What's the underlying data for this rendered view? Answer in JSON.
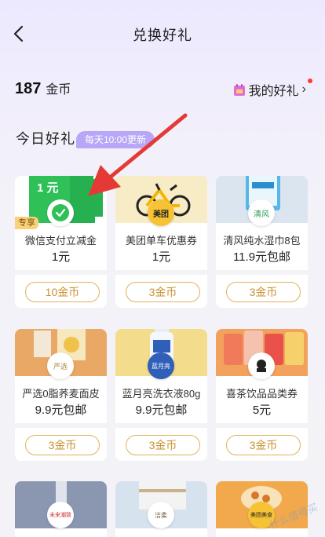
{
  "header": {
    "title": "兑换好礼"
  },
  "balance": {
    "amount": "187",
    "unit": "金币"
  },
  "my_gifts": {
    "label": "我的好礼",
    "chevron": "›"
  },
  "section": {
    "title": "今日好礼",
    "badge": "每天10:00更新"
  },
  "cards": [
    {
      "name": "微信支付立减金",
      "price": "1元",
      "button": "10金币",
      "tag": "专享",
      "top_label": "1 元",
      "icon": "wechat-icon"
    },
    {
      "name": "美团单车优惠券",
      "price": "1元",
      "button": "3金币",
      "icon": "meituan-logo"
    },
    {
      "name": "清风纯水湿巾8包",
      "price": "11.9元包邮",
      "button": "3金币",
      "icon": "qingfeng-logo"
    },
    {
      "name": "严选0脂荞麦面皮",
      "price": "9.9元包邮",
      "button": "3金币",
      "icon": "yanxuan-logo"
    },
    {
      "name": "蓝月亮洗衣液80g",
      "price": "9.9元包邮",
      "button": "3金币",
      "icon": "bluemoon-logo"
    },
    {
      "name": "喜茶饮品品类券",
      "price": "5元",
      "button": "3金币",
      "icon": "heytea-logo"
    }
  ],
  "bottom_cards": [
    {
      "icon": "weilai-logo",
      "logo_text": "未来潮致"
    },
    {
      "icon": "jieyou-logo",
      "logo_text": "洁柔"
    },
    {
      "icon": "snack-logo",
      "logo_text": "美团美食"
    }
  ],
  "watermark": "什么值得买",
  "colors": {
    "accent": "#b8a6f6",
    "button_border": "#e2b25a",
    "button_text": "#c9922f",
    "arrow": "#e53935"
  }
}
